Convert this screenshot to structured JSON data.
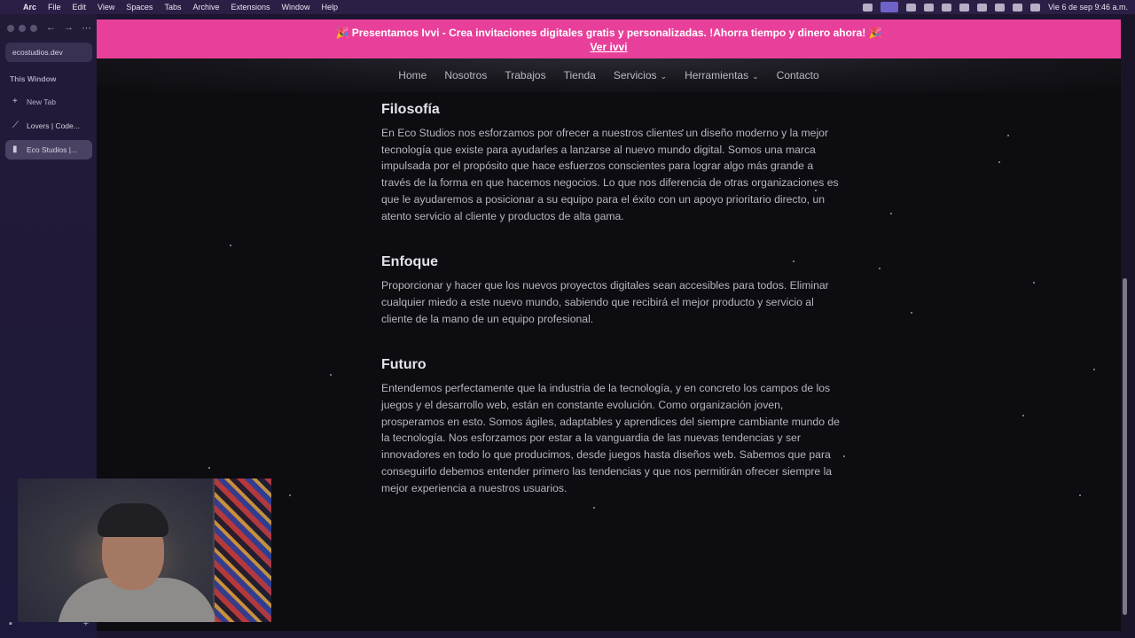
{
  "menubar": {
    "app": "Arc",
    "items": [
      "File",
      "Edit",
      "View",
      "Spaces",
      "Tabs",
      "Archive",
      "Extensions",
      "Window",
      "Help"
    ],
    "clock": "Vie 6 de sep  9:46 a.m."
  },
  "sidebar": {
    "url": "ecostudios.dev",
    "section_title": "This Window",
    "new_tab": "New Tab",
    "tabs": [
      {
        "label": "Lovers | Code..."
      },
      {
        "label": "Eco Studios |..."
      }
    ]
  },
  "banner": {
    "text": "🎉 Presentamos Ivvi - Crea invitaciones digitales gratis y personalizadas. !Ahorra tiempo y dinero ahora! 🎉",
    "link": "Ver ivvi"
  },
  "nav": {
    "items": [
      "Home",
      "Nosotros",
      "Trabajos",
      "Tienda",
      "Servicios",
      "Herramientas",
      "Contacto"
    ]
  },
  "sections": [
    {
      "title": "Filosofía",
      "body": "En Eco Studios nos esforzamos por ofrecer a nuestros clientes un diseño moderno y la mejor tecnología que existe para ayudarles a lanzarse al nuevo mundo digital. Somos una marca impulsada por el propósito que hace esfuerzos conscientes para lograr algo más grande a través de la forma en que hacemos negocios. Lo que nos diferencia de otras organizaciones es que le ayudaremos a posicionar a su equipo para el éxito con un apoyo prioritario directo, un atento servicio al cliente y productos de alta gama."
    },
    {
      "title": "Enfoque",
      "body": "Proporcionar y hacer que los nuevos proyectos digitales sean accesibles para todos. Eliminar cualquier miedo a este nuevo mundo, sabiendo que recibirá el mejor producto y servicio al cliente de la mano de un equipo profesional."
    },
    {
      "title": "Futuro",
      "body": "Entendemos perfectamente que la industria de la tecnología, y en concreto los campos de los juegos y el desarrollo web, están en constante evolución. Como organización joven, prosperamos en esto. Somos ágiles, adaptables y aprendices del siempre cambiante mundo de la tecnología. Nos esforzamos por estar a la vanguardia de las nuevas tendencias y ser innovadores en todo lo que producimos, desde juegos hasta diseños web. Sabemos que para conseguirlo debemos entender primero las tendencias y que nos permitirán ofrecer siempre la mejor experiencia a nuestros usuarios."
    }
  ],
  "colors": {
    "banner": "#e8409a",
    "page_background": "#0d0c10",
    "sidebar": "#231a38"
  }
}
